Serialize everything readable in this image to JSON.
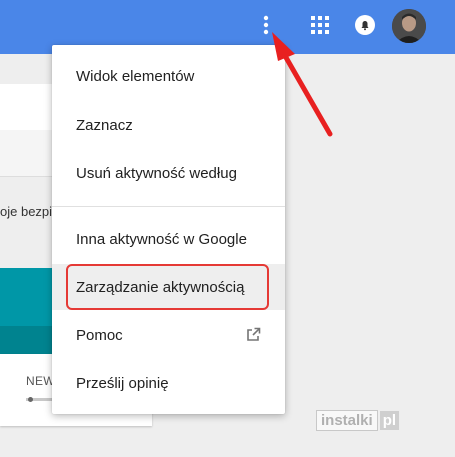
{
  "topbar": {
    "color": "#4a86e8",
    "more_icon": "more-vert-icon",
    "apps_icon": "apps-grid-icon",
    "notifications_icon": "bell-icon",
    "avatar_icon": "user-avatar"
  },
  "background_page": {
    "partial_text": "oje bezpi",
    "new_label": "NEW"
  },
  "menu": {
    "items": [
      {
        "label": "Widok elementów"
      },
      {
        "label": "Zaznacz"
      },
      {
        "label": "Usuń aktywność według"
      },
      {
        "label": "Inna aktywność w Google"
      },
      {
        "label": "Zarządzanie aktywnością"
      },
      {
        "label": "Pomoc",
        "icon": "open-in-new-icon"
      },
      {
        "label": "Prześlij opinię"
      }
    ],
    "highlighted_item": "Zarządzanie aktywnością",
    "highlight_color": "#e53935"
  },
  "annotation": {
    "arrow_color": "#e82020"
  },
  "watermark": {
    "text": "instalki",
    "suffix": "pl"
  }
}
